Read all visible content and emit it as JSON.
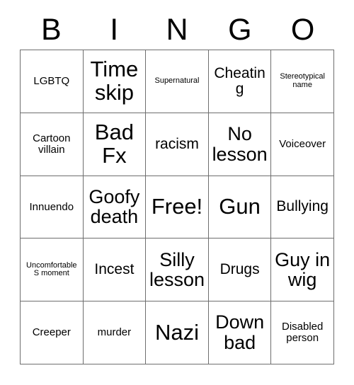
{
  "card": {
    "title": "Bingo Card",
    "header_letters": [
      "B",
      "I",
      "N",
      "G",
      "O"
    ],
    "colors": {
      "background": "#ffffff",
      "text": "#000000",
      "grid_border": "#6e6e6e"
    },
    "grid_size": "5x5",
    "free_space": {
      "label": "Free!",
      "row": 3,
      "column": 3
    },
    "rows": [
      [
        {
          "label": "LGBTQ",
          "size": "sm"
        },
        {
          "label": "Time skip",
          "size": "xl"
        },
        {
          "label": "Supernatural",
          "size": "xs"
        },
        {
          "label": "Cheating",
          "size": "md"
        },
        {
          "label": "Stereotypical name",
          "size": "xs"
        }
      ],
      [
        {
          "label": "Cartoon villain",
          "size": "sm"
        },
        {
          "label": "Bad Fx",
          "size": "xl"
        },
        {
          "label": "racism",
          "size": "md"
        },
        {
          "label": "No lesson",
          "size": "lg"
        },
        {
          "label": "Voiceover",
          "size": "sm"
        }
      ],
      [
        {
          "label": "Innuendo",
          "size": "sm"
        },
        {
          "label": "Goofy death",
          "size": "lg"
        },
        {
          "label": "Free!",
          "size": "xl"
        },
        {
          "label": "Gun",
          "size": "xl"
        },
        {
          "label": "Bullying",
          "size": "md"
        }
      ],
      [
        {
          "label": "Uncomfortable S moment",
          "size": "xs"
        },
        {
          "label": "Incest",
          "size": "md"
        },
        {
          "label": "Silly lesson",
          "size": "lg"
        },
        {
          "label": "Drugs",
          "size": "md"
        },
        {
          "label": "Guy in wig",
          "size": "lg"
        }
      ],
      [
        {
          "label": "Creeper",
          "size": "sm"
        },
        {
          "label": "murder",
          "size": "sm"
        },
        {
          "label": "Nazi",
          "size": "xl"
        },
        {
          "label": "Down bad",
          "size": "lg"
        },
        {
          "label": "Disabled person",
          "size": "sm"
        }
      ]
    ]
  }
}
